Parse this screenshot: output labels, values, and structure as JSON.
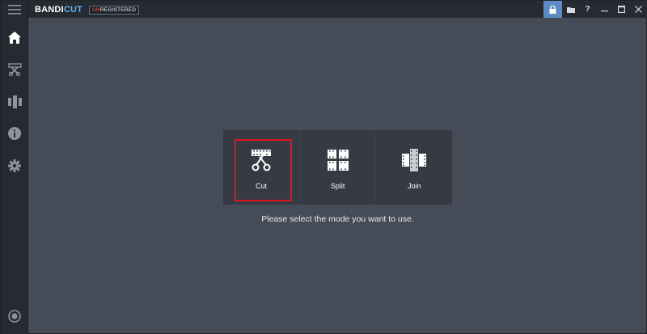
{
  "app": {
    "logo_main": "BANDI",
    "logo_accent": "CUT",
    "badge_un": "UN",
    "badge_rest": "REGISTERED"
  },
  "titlebar": {
    "buttons": [
      {
        "name": "lock-icon",
        "glyph": "🔒"
      },
      {
        "name": "folder-icon",
        "glyph": "▰"
      },
      {
        "name": "help-icon",
        "glyph": "?"
      },
      {
        "name": "minimize-icon",
        "glyph": "—"
      },
      {
        "name": "maximize-icon",
        "glyph": "▭"
      },
      {
        "name": "close-icon",
        "glyph": "✕"
      }
    ]
  },
  "sidebar": {
    "items": [
      {
        "name": "menu-icon"
      },
      {
        "name": "home-icon"
      },
      {
        "name": "cut-tool-icon"
      },
      {
        "name": "join-tool-icon"
      },
      {
        "name": "info-icon"
      },
      {
        "name": "settings-icon"
      },
      {
        "name": "record-icon"
      }
    ]
  },
  "modes": [
    {
      "label": "Cut",
      "icon": "scissors-film-icon",
      "selected": true
    },
    {
      "label": "Split",
      "icon": "split-film-icon",
      "selected": false
    },
    {
      "label": "Join",
      "icon": "join-film-icon",
      "selected": false
    }
  ],
  "hint_text": "Please select the mode you want to use.",
  "colors": {
    "accent": "#56b5ff",
    "selection_border": "#e0161f",
    "active_button": "#5b8bc4",
    "background": "#454c58"
  }
}
